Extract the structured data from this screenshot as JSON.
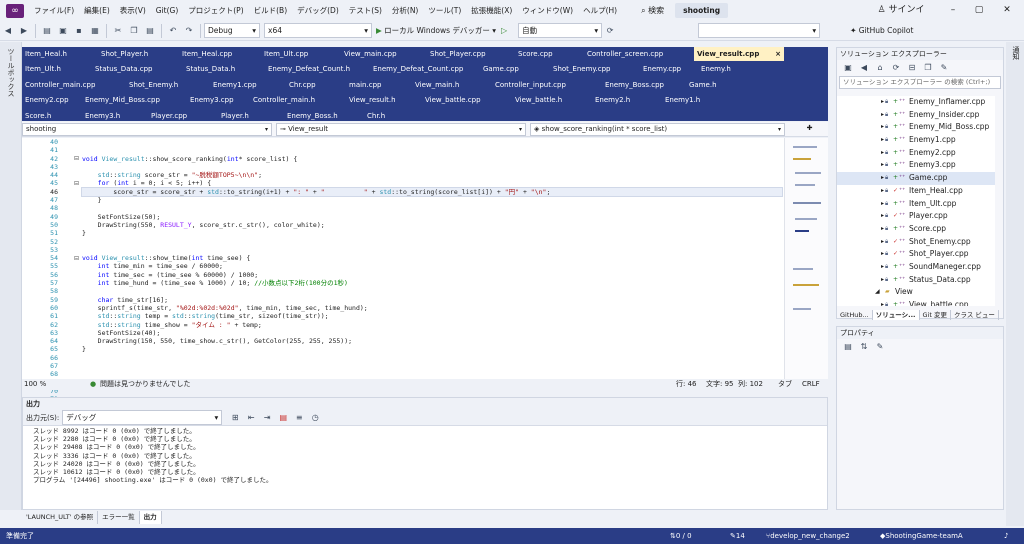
{
  "menu": [
    "ファイル(F)",
    "編集(E)",
    "表示(V)",
    "Git(G)",
    "プロジェクト(P)",
    "ビルド(B)",
    "デバッグ(D)",
    "テスト(S)",
    "分析(N)",
    "ツール(T)",
    "拡張機能(X)",
    "ウィンドウ(W)",
    "ヘルプ(H)"
  ],
  "search_label": "検索",
  "project_name": "shooting",
  "signin": "サインイン",
  "copilot": "GitHub Copilot",
  "toolbar": {
    "config": "Debug",
    "platform": "x64",
    "run_label": "ローカル Windows デバッガー",
    "auto": "自動"
  },
  "left_strip": "ツールボックス",
  "right_strip": "通知",
  "tabs": [
    [
      {
        "label": "Item_Heal.h",
        "w": 76
      },
      {
        "label": "Shot_Player.h",
        "w": 81
      },
      {
        "label": "Item_Heal.cpp",
        "w": 82
      },
      {
        "label": "Item_Ult.cpp",
        "w": 80
      },
      {
        "label": "View_main.cpp",
        "w": 86
      },
      {
        "label": "Shot_Player.cpp",
        "w": 88
      },
      {
        "label": "Score.cpp",
        "w": 69
      },
      {
        "label": "Controller_screen.cpp",
        "w": 110
      },
      {
        "label": "View_result.cpp",
        "w": 90,
        "active": true
      }
    ],
    [
      {
        "label": "Item_Ult.h",
        "w": 70
      },
      {
        "label": "Status_Data.cpp",
        "w": 91
      },
      {
        "label": "Status_Data.h",
        "w": 82
      },
      {
        "label": "Enemy_Defeat_Count.h",
        "w": 105
      },
      {
        "label": "Enemy_Defeat_Count.cpp",
        "w": 110
      },
      {
        "label": "Game.cpp",
        "w": 70
      },
      {
        "label": "Shot_Enemy.cpp",
        "w": 90
      },
      {
        "label": "Enemy.cpp",
        "w": 58
      },
      {
        "label": "Enemy.h",
        "w": 52
      }
    ],
    [
      {
        "label": "Controller_main.cpp",
        "w": 104
      },
      {
        "label": "Shot_Enemy.h",
        "w": 84
      },
      {
        "label": "Enemy1.cpp",
        "w": 76
      },
      {
        "label": "Chr.cpp",
        "w": 60
      },
      {
        "label": "main.cpp",
        "w": 66
      },
      {
        "label": "View_main.h",
        "w": 80
      },
      {
        "label": "Controller_input.cpp",
        "w": 110
      },
      {
        "label": "Enemy_Boss.cpp",
        "w": 84
      },
      {
        "label": "Game.h",
        "w": 60
      }
    ],
    [
      {
        "label": "Enemy2.cpp",
        "w": 60
      },
      {
        "label": "Enemy_Mid_Boss.cpp",
        "w": 105
      },
      {
        "label": "Enemy3.cpp",
        "w": 63
      },
      {
        "label": "Controller_main.h",
        "w": 96
      },
      {
        "label": "View_result.h",
        "w": 76
      },
      {
        "label": "View_battle.cpp",
        "w": 90
      },
      {
        "label": "View_battle.h",
        "w": 80
      },
      {
        "label": "Enemy2.h",
        "w": 70
      },
      {
        "label": "Enemy1.h",
        "w": 60
      }
    ],
    [
      {
        "label": "Score.h",
        "w": 60
      },
      {
        "label": "Enemy3.h",
        "w": 66
      },
      {
        "label": "Player.cpp",
        "w": 70
      },
      {
        "label": "Player.h",
        "w": 66
      },
      {
        "label": "Enemy_Boss.h",
        "w": 80
      },
      {
        "label": "Chr.h",
        "w": 60
      }
    ]
  ],
  "nav": {
    "project": "shooting",
    "class": "View_result",
    "member": "show_score_ranking(int * score_list)"
  },
  "line_numbers": [
    "40",
    "41",
    "42",
    "43",
    "44",
    "45",
    "46",
    "47",
    "48",
    "49",
    "50",
    "51",
    "52",
    "53",
    "54",
    "55",
    "56",
    "57",
    "58",
    "59",
    "60",
    "61",
    "62",
    "63",
    "64",
    "65",
    "66",
    "67",
    "68",
    "69",
    "70",
    "71",
    "72",
    "73",
    "74",
    "75"
  ],
  "current_line": "46",
  "code": [
    "",
    "",
    "void View_result::show_score_ranking(int* score_list) {",
    "",
    "    std::string score_str = \"~脱税額TOP5~\\n\\n\";",
    "    for (int i = 0; i < 5; i++) {",
    "        score_str = score_str + std::to_string(i+1) + \": \" + \"          \" + std::to_string(score_list[i]) + \"円\" + \"\\n\";",
    "    }",
    "",
    "    SetFontSize(50);",
    "    DrawString(550, RESULT_Y, score_str.c_str(), color_white);",
    "}",
    "",
    "",
    "void View_result::show_time(int time_see) {",
    "    int time_min = time_see / 60000;",
    "    int time_sec = (time_see % 60000) / 1000;",
    "    int time_hund = (time_see % 1000) / 10; //小数点以下2桁(100分の1秒)",
    "",
    "    char time_str[16];",
    "    sprintf_s(time_str, \"%02d:%02d:%02d\", time_min, time_sec, time_hund);",
    "    std::string temp = std::string(time_str, sizeof(time_str));",
    "    std::string time_show = \"タイム : \" + temp;",
    "    SetFontSize(40);",
    "    DrawString(150, 550, time_show.c_str(), GetColor(255, 255, 255));",
    "}",
    "",
    "",
    "",
    "",
    "",
    "",
    "",
    "",
    "",
    ""
  ],
  "editor_status": {
    "zoom": "100 %",
    "issues": "問題は見つかりませんでした",
    "line": "行: 46",
    "char": "文字: 95",
    "col": "列: 102",
    "tab": "タブ",
    "eol": "CRLF"
  },
  "output": {
    "title": "出力",
    "source_label": "出力元(S):",
    "source_value": "デバッグ",
    "lines": [
      "スレッド 8992 はコード 0 (0x0) で終了しました。",
      "スレッド 2280 はコード 0 (0x0) で終了しました。",
      "スレッド 29408 はコード 0 (0x0) で終了しました。",
      "スレッド 3336 はコード 0 (0x0) で終了しました。",
      "スレッド 24020 はコード 0 (0x0) で終了しました。",
      "スレッド 10612 はコード 0 (0x0) で終了しました。",
      "プログラム '[24496] shooting.exe' はコード 0 (0x0) で終了しました。"
    ]
  },
  "bottom_tabs": [
    "'LAUNCH_ULT' の参照",
    "エラー一覧",
    "出力"
  ],
  "solution_explorer": {
    "title": "ソリューション エクスプローラー",
    "search_placeholder": "ソリューション エクスプローラー の検索 (Ctrl+;)",
    "items": [
      {
        "name": "Enemy_Inflamer.cpp",
        "mark": "+"
      },
      {
        "name": "Enemy_Insider.cpp",
        "mark": "+"
      },
      {
        "name": "Enemy_Mid_Boss.cpp",
        "mark": "+"
      },
      {
        "name": "Enemy1.cpp",
        "mark": "+"
      },
      {
        "name": "Enemy2.cpp",
        "mark": "+"
      },
      {
        "name": "Enemy3.cpp",
        "mark": "+"
      },
      {
        "name": "Game.cpp",
        "mark": "+",
        "selected": true
      },
      {
        "name": "Item_Heal.cpp",
        "mark": "✓"
      },
      {
        "name": "Item_Ult.cpp",
        "mark": "+"
      },
      {
        "name": "Player.cpp",
        "mark": "✓"
      },
      {
        "name": "Score.cpp",
        "mark": "+"
      },
      {
        "name": "Shot_Enemy.cpp",
        "mark": "✓"
      },
      {
        "name": "Shot_Player.cpp",
        "mark": "✓"
      },
      {
        "name": "SoundManeger.cpp",
        "mark": "+"
      },
      {
        "name": "Status_Data.cpp",
        "mark": "+"
      },
      {
        "name": "View",
        "mark": ""
      },
      {
        "name": "View_battle.cpp",
        "mark": "+"
      }
    ],
    "tabs": [
      "GitHub...",
      "ソリューシ...",
      "Git 変更",
      "クラス ビュー"
    ]
  },
  "properties_title": "プロパティ",
  "status": {
    "ready": "準備完了",
    "arrows": "0 / 0",
    "pencil": "14",
    "branch": "develop_new_change2",
    "repo": "ShootingGame-teamA"
  }
}
